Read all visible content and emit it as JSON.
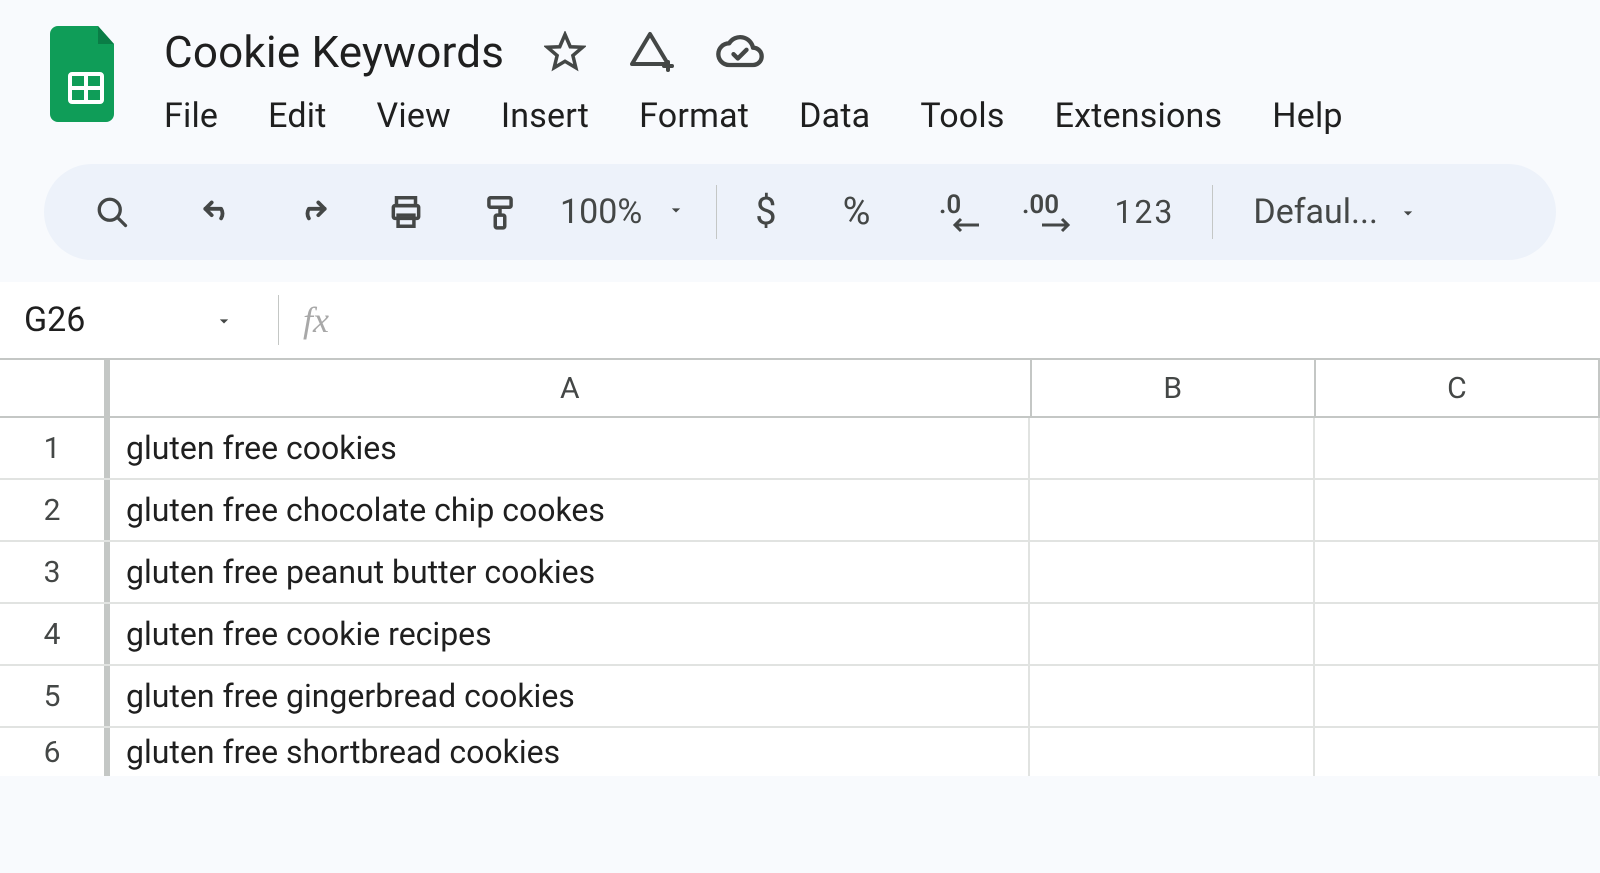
{
  "header": {
    "title": "Cookie Keywords",
    "menus": [
      "File",
      "Edit",
      "View",
      "Insert",
      "Format",
      "Data",
      "Tools",
      "Extensions",
      "Help"
    ]
  },
  "toolbar": {
    "zoom": "100%",
    "currency": "$",
    "percent": "%",
    "decrease_dec_icon_text": ".0",
    "increase_dec_icon_text": ".00",
    "num_format": "123",
    "font": "Defaul..."
  },
  "name_box": {
    "value": "G26"
  },
  "columns": [
    "A",
    "B",
    "C"
  ],
  "rows": [
    {
      "n": "1",
      "a": "gluten free cookies",
      "b": "",
      "c": ""
    },
    {
      "n": "2",
      "a": "gluten free chocolate chip cookes",
      "b": "",
      "c": ""
    },
    {
      "n": "3",
      "a": "gluten free peanut butter cookies",
      "b": "",
      "c": ""
    },
    {
      "n": "4",
      "a": "gluten free cookie recipes",
      "b": "",
      "c": ""
    },
    {
      "n": "5",
      "a": "gluten free gingerbread cookies",
      "b": "",
      "c": ""
    },
    {
      "n": "6",
      "a": "gluten free shortbread cookies",
      "b": "",
      "c": ""
    }
  ]
}
